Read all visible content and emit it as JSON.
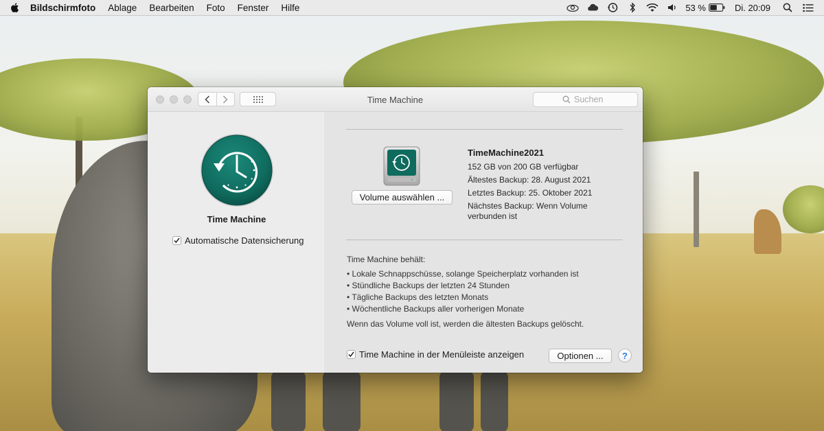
{
  "menubar": {
    "app_name": "Bildschirmfoto",
    "items": [
      "Ablage",
      "Bearbeiten",
      "Foto",
      "Fenster",
      "Hilfe"
    ],
    "battery": "53 %",
    "clock": "Di. 20:09",
    "status_icons": [
      "creative-cloud-icon",
      "icloud-icon",
      "time-machine-icon",
      "bluetooth-icon",
      "wifi-icon",
      "volume-icon",
      "battery-icon",
      "spotlight-icon",
      "notification-center-icon"
    ]
  },
  "window": {
    "title": "Time Machine",
    "search_placeholder": "Suchen"
  },
  "left": {
    "name": "Time Machine",
    "auto_backup_label": "Automatische Datensicherung",
    "auto_backup_checked": true
  },
  "right": {
    "volume_name": "TimeMachine2021",
    "available": "152 GB von 200 GB verfügbar",
    "oldest": "Ältestes Backup: 28. August 2021",
    "latest": "Letztes Backup: 25. Oktober 2021",
    "next": "Nächstes Backup: Wenn Volume verbunden ist",
    "select_volume_label": "Volume auswählen ...",
    "keeps_header": "Time Machine behält:",
    "keeps": [
      "• Lokale Schnappschüsse, solange Speicherplatz vorhanden ist",
      "• Stündliche Backups der letzten 24 Stunden",
      "• Tägliche Backups des letzten Monats",
      "• Wöchentliche Backups aller vorherigen Monate"
    ],
    "full_note": "Wenn das Volume voll ist, werden die ältesten Backups gelöscht.",
    "show_in_menubar_label": "Time Machine in der Menüleiste anzeigen",
    "show_in_menubar_checked": true,
    "options_label": "Optionen ...",
    "help_label": "?"
  },
  "colors": {
    "tm_green": "#0f6b5e",
    "accent_blue": "#2a7be0"
  }
}
